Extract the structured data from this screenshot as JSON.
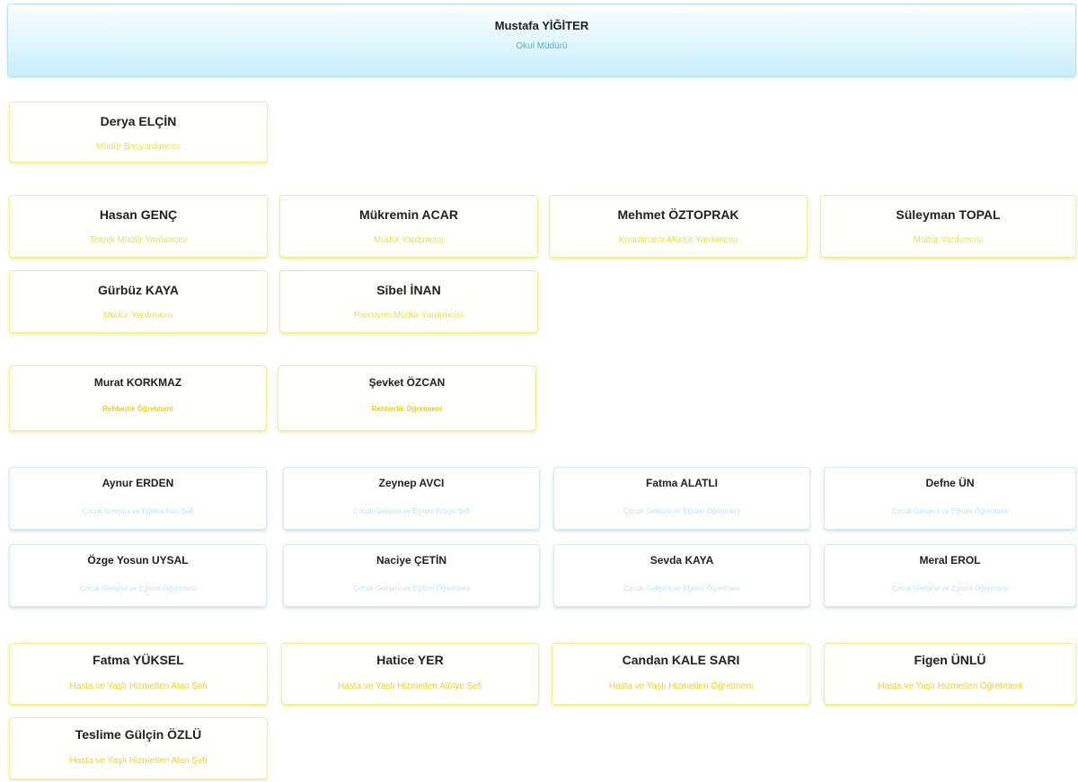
{
  "principal": {
    "name": "Mustafa YİĞİTER",
    "role": "Okul Müdürü"
  },
  "deputy_head": {
    "name": "Derya ELÇİN",
    "role": "Müdür Başyardımcısı"
  },
  "assistants": [
    {
      "name": "Hasan GENÇ",
      "role": "Teknik Müdür Yardımcısı"
    },
    {
      "name": "Mükremin ACAR",
      "role": "Müdür Yardımcısı"
    },
    {
      "name": "Mehmet ÖZTOPRAK",
      "role": "Koordinatör Müdür Yardımcısı"
    },
    {
      "name": "Süleyman TOPAL",
      "role": "Müdür Yardımcısı"
    },
    {
      "name": "Gürbüz KAYA",
      "role": "Müdür Yardımcısı"
    },
    {
      "name": "Sibel İNAN",
      "role": "Pansiyon Müdür Yardımcısı"
    }
  ],
  "counselors": [
    {
      "name": "Murat KORKMAZ",
      "role": "Rehberlik Öğretmeni"
    },
    {
      "name": "Şevket ÖZCAN",
      "role": "Rehberlik Öğretmeni"
    }
  ],
  "child_dev": [
    {
      "name": "Aynur ERDEN",
      "role": "Çocuk Gelişimi ve Eğitimi Alan Şefi"
    },
    {
      "name": "Zeynep AVCI",
      "role": "Çocuk Gelişimi ve Eğitimi Atölye Şefi"
    },
    {
      "name": "Fatma ALATLI",
      "role": "Çocuk Gelişimi ve Eğitimi Öğretmeni"
    },
    {
      "name": "Defne ÜN",
      "role": "Çocuk Gelişimi ve Eğitimi Öğretmeni"
    },
    {
      "name": "Özge Yosun UYSAL",
      "role": "Çocuk Gelişimi ve Eğitimi Öğretmeni"
    },
    {
      "name": "Naciye ÇETİN",
      "role": "Çocuk Gelişimi ve Eğitimi Öğretmeni"
    },
    {
      "name": "Sevda KAYA",
      "role": "Çocuk Gelişimi ve Eğitimi Öğretmeni"
    },
    {
      "name": "Meral EROL",
      "role": "Çocuk Gelişimi ve Eğitimi Öğretmeni"
    }
  ],
  "elderly_care": [
    {
      "name": "Fatma YÜKSEL",
      "role": "Hasta ve Yaşlı Hizmetleri Alan Şefi"
    },
    {
      "name": "Hatice YER",
      "role": "Hasta ve Yaşlı Hizmetleri Atölye Şefi"
    },
    {
      "name": "Candan KALE SARI",
      "role": "Hasta ve Yaşlı Hizmetleri Öğretmeni"
    },
    {
      "name": "Figen ÜNLÜ",
      "role": "Hasta ve Yaşlı Hizmetleri Öğretmeni"
    },
    {
      "name": "Teslime Gülçin ÖZLÜ",
      "role": "Hasta ve Yaşlı Hizmetleri Alan Şefi"
    }
  ]
}
